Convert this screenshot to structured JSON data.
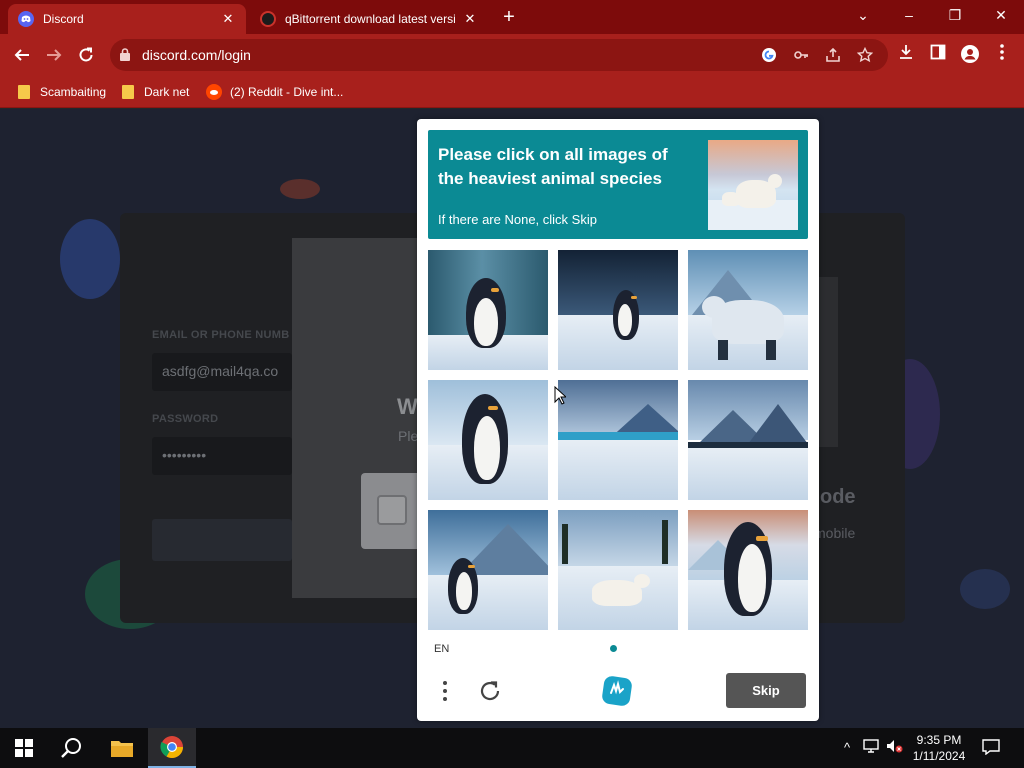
{
  "browser": {
    "tabs": [
      {
        "label": "Discord",
        "icon": "discord-icon",
        "active": true
      },
      {
        "label": "qBittorrent download latest versi",
        "icon": "qbittorrent-icon",
        "active": false
      }
    ],
    "new_tab_label": "+",
    "url": "discord.com/login",
    "bookmarks": [
      {
        "label": "Scambaiting",
        "icon": "folder-icon"
      },
      {
        "label": "Dark net",
        "icon": "folder-icon"
      },
      {
        "label": "(2) Reddit - Dive int...",
        "icon": "reddit-icon"
      }
    ],
    "window_controls": {
      "dropdown": "⌄",
      "minimize": "–",
      "restore": "❐",
      "close": "✕"
    }
  },
  "background_page": {
    "email_label": "EMAIL OR PHONE NUMB",
    "email_value": "asdfg@mail4qa.co",
    "password_label": "PASSWORD",
    "password_value": "•••••••••",
    "modal_heading": "W",
    "modal_text": "Ple",
    "side_text": "ode",
    "side_text2": "mobile"
  },
  "captcha": {
    "question": "Please click on all images of the heaviest animal species",
    "hint": "If there are None, click Skip",
    "language": "EN",
    "skip_label": "Skip",
    "tiles": [
      {
        "subject": "penguin"
      },
      {
        "subject": "penguin"
      },
      {
        "subject": "polar-bear"
      },
      {
        "subject": "penguin"
      },
      {
        "subject": "landscape"
      },
      {
        "subject": "landscape"
      },
      {
        "subject": "penguin"
      },
      {
        "subject": "polar-bear"
      },
      {
        "subject": "penguin"
      }
    ],
    "accent_color": "#0b8a94"
  },
  "taskbar": {
    "time": "9:35 PM",
    "date": "1/11/2024",
    "apps": [
      "start-icon",
      "search-icon",
      "file-explorer-icon",
      "chrome-icon"
    ]
  },
  "colors": {
    "chrome_frame": "#7d0b0b",
    "chrome_toolbar": "#a8201c",
    "taskbar": "#0d0d0f"
  }
}
